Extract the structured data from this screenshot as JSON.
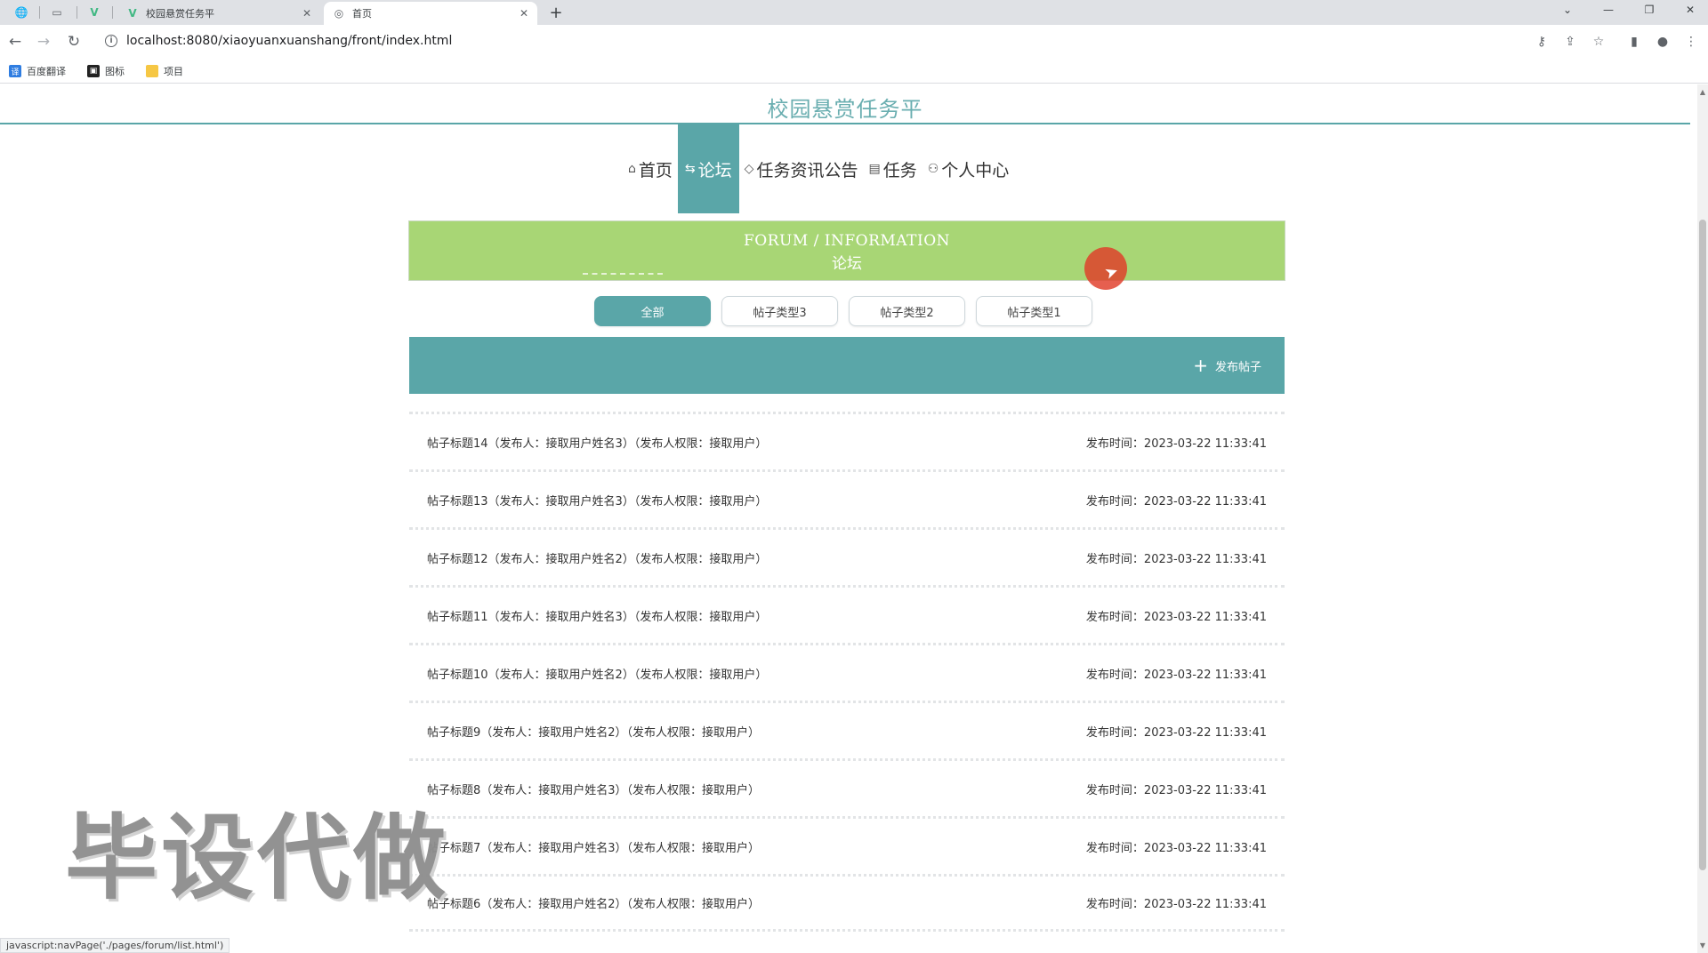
{
  "browser": {
    "tabs": [
      {
        "title": "校园悬赏任务平",
        "icon": "vue-icon"
      },
      {
        "title": "首页",
        "icon": "globe-icon"
      }
    ],
    "url": "localhost:8080/xiaoyuanxuanshang/front/index.html",
    "bookmarks": [
      "百度翻译",
      "图标",
      "项目"
    ],
    "status_text": "javascript:navPage('./pages/forum/list.html')"
  },
  "site": {
    "title": "校园悬赏任务平"
  },
  "nav": {
    "items": [
      {
        "label": "首页",
        "icon": "home-icon"
      },
      {
        "label": "论坛",
        "icon": "forum-icon",
        "active": true
      },
      {
        "label": "任务资讯公告",
        "icon": "tag-icon"
      },
      {
        "label": "任务",
        "icon": "list-icon"
      },
      {
        "label": "个人中心",
        "icon": "user-icon"
      }
    ]
  },
  "banner": {
    "en": "FORUM / INFORMATION",
    "cn": "论坛"
  },
  "filters": [
    "全部",
    "帖子类型3",
    "帖子类型2",
    "帖子类型1"
  ],
  "action": {
    "publish_label": "发布帖子"
  },
  "posts": [
    {
      "title": "帖子标题14（发布人：接取用户姓名3）（发布人权限：接取用户）",
      "time": "发布时间：2023-03-22 11:33:41"
    },
    {
      "title": "帖子标题13（发布人：接取用户姓名3）（发布人权限：接取用户）",
      "time": "发布时间：2023-03-22 11:33:41"
    },
    {
      "title": "帖子标题12（发布人：接取用户姓名2）（发布人权限：接取用户）",
      "time": "发布时间：2023-03-22 11:33:41"
    },
    {
      "title": "帖子标题11（发布人：接取用户姓名3）（发布人权限：接取用户）",
      "time": "发布时间：2023-03-22 11:33:41"
    },
    {
      "title": "帖子标题10（发布人：接取用户姓名2）（发布人权限：接取用户）",
      "time": "发布时间：2023-03-22 11:33:41"
    },
    {
      "title": "帖子标题9（发布人：接取用户姓名2）（发布人权限：接取用户）",
      "time": "发布时间：2023-03-22 11:33:41"
    },
    {
      "title": "帖子标题8（发布人：接取用户姓名3）（发布人权限：接取用户）",
      "time": "发布时间：2023-03-22 11:33:41"
    },
    {
      "title": "帖子标题7（发布人：接取用户姓名3）（发布人权限：接取用户）",
      "time": "发布时间：2023-03-22 11:33:41"
    },
    {
      "title": "帖子标题6（发布人：接取用户姓名2）（发布人权限：接取用户）",
      "time": "发布时间：2023-03-22 11:33:41"
    }
  ],
  "watermark": "毕设代做",
  "colors": {
    "accent": "#5aa6a8",
    "banner": "#a8d675",
    "title": "#6aaeb0"
  }
}
